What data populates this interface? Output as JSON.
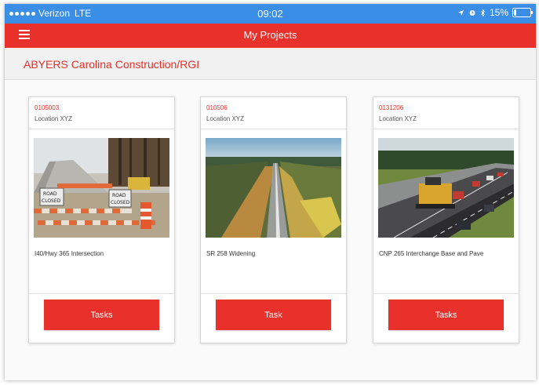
{
  "status_bar": {
    "carrier": "Verizon",
    "network": "LTE",
    "time": "09:02",
    "battery": "15%",
    "battery_level": 0.15,
    "icons": [
      "signal-dots-icon",
      "location-arrow-icon",
      "alarm-icon",
      "bluetooth-icon",
      "battery-icon"
    ]
  },
  "app_bar": {
    "title": "My Projects",
    "menu_icon": "hamburger-menu-icon"
  },
  "subheader": {
    "company": "ABYERS Carolina Construction/RGI"
  },
  "projects": [
    {
      "code": "0105003",
      "location": "Location XYZ",
      "description": "I40/Hwy 365 Intersection",
      "button": "Tasks",
      "image": "road-closed-construction-photo"
    },
    {
      "code": "010506",
      "location": "Location XYZ",
      "description": "SR 258 Widening",
      "button": "Task",
      "image": "highway-aerial-photo"
    },
    {
      "code": "0131206",
      "location": "Location XYZ",
      "description": "CNP 265 Interchange Base and Pave",
      "button": "Tasks",
      "image": "highway-paving-photo"
    }
  ],
  "colors": {
    "status_bar": "#3a8ee6",
    "brand_red": "#e8312a"
  }
}
